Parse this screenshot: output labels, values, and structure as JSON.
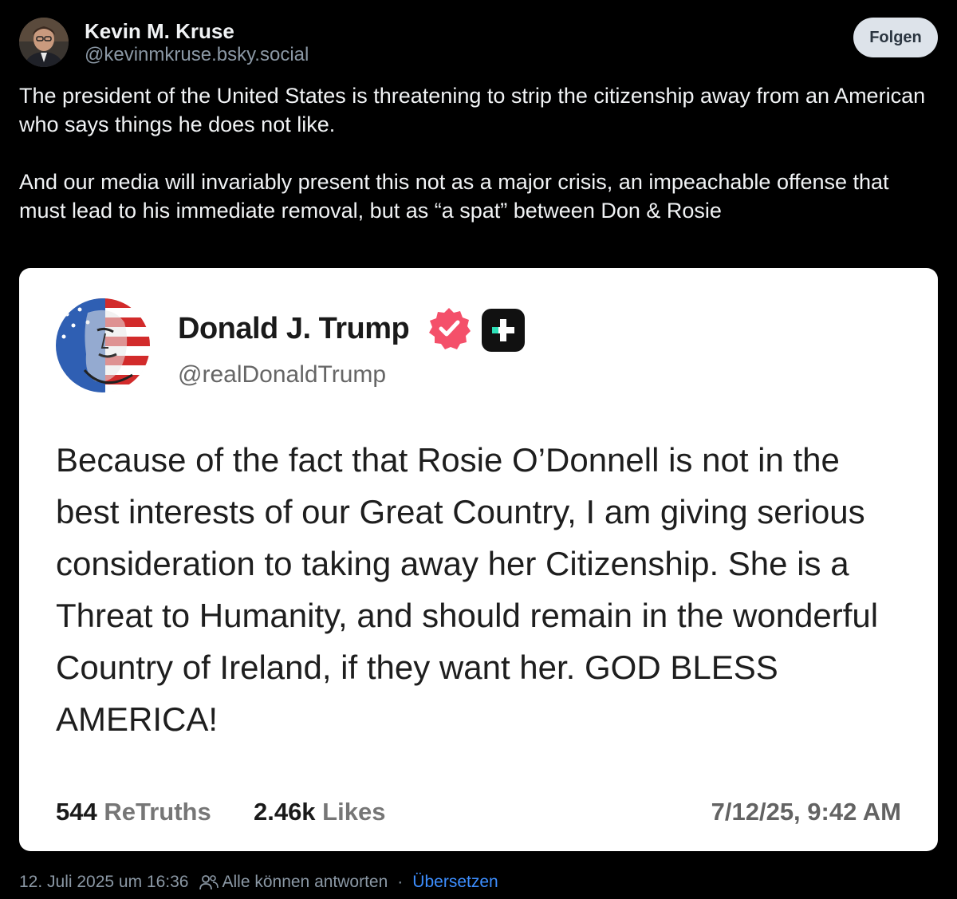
{
  "post": {
    "author_name": "Kevin M. Kruse",
    "author_handle": "@kevinmkruse.bsky.social",
    "follow_label": "Folgen",
    "paragraphs": [
      "The president of the United States is threatening to strip the citizenship away from an American who says things he does not like.",
      "And our media will invariably present this not as a major crisis, an impeachable offense that must lead to his immediate removal, but as “a spat” between Don & Rosie"
    ]
  },
  "embed": {
    "name": "Donald J. Trump",
    "handle": "@realDonaldTrump",
    "verified_icon": "verified-badge-icon",
    "platform_icon": "plus-icon",
    "body": "Because of the fact that Rosie O’Donnell is not in the best interests of our Great Country, I am giving serious consideration to taking away her Citizenship. She is a Threat to Humanity, and should remain in the wonderful Country of Ireland, if they want her. GOD BLESS AMERICA!",
    "retruths_count": "544",
    "retruths_label": "ReTruths",
    "likes_count": "2.46k",
    "likes_label": "Likes",
    "date": "7/12/25, 9:42 AM",
    "verified_color": "#f4506a"
  },
  "footer": {
    "timestamp": "12. Juli 2025 um 16:36",
    "reply_setting": "Alle können antworten",
    "separator": "·",
    "translate_label": "Übersetzen"
  }
}
